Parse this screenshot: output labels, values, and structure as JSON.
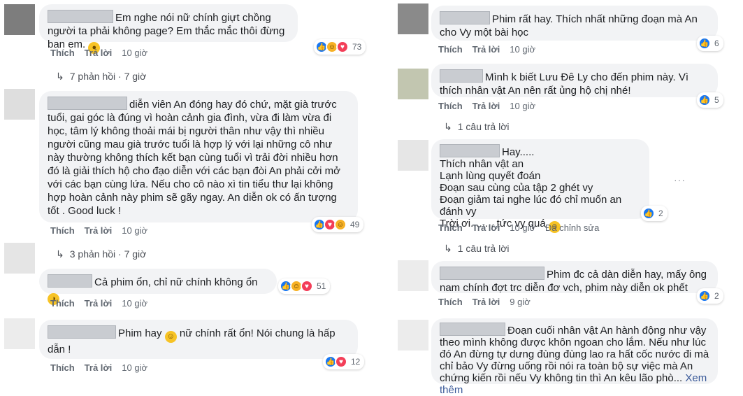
{
  "left": {
    "comments": [
      {
        "text": "Em nghe nói nữ chính giựt chồng người ta phải không page? Em thắc mắc thôi đừng ban em.",
        "emoji": "😣",
        "like": "Thích",
        "reply": "Trả lời",
        "time": "10 giờ",
        "reaction_count": "73"
      },
      {
        "text": "diễn viên An đóng hay đó chứ, mặt già trước tuổi, gai góc là đúng vì hoàn cảnh gia đình, vừa đi làm vừa đi học, tâm lý không thoải mái bị người thân như vậy thì nhiều người cũng mau già trước tuổi là hợp lý với lại những cô như này thường không thích kết bạn cùng tuổi vì trải đời nhiều hơn đó là giải thích hộ cho đạo diễn với các bạn đòi An phải cởi mở với các bạn cùng lứa. Nếu cho cô nào xì tin tiểu thư lại không hợp hoàn cảnh này phim sẽ gãy ngay. An diễn ok có ấn tượng tốt . Good luck !",
        "like": "Thích",
        "reply": "Trả lời",
        "time": "10 giờ",
        "reaction_count": "49"
      },
      {
        "text": "Cả phim ổn, chỉ nữ chính không ổn",
        "like": "Thích",
        "reply": "Trả lời",
        "time": "10 giờ",
        "reaction_count": "51"
      },
      {
        "text_a": "Phim hay",
        "text_b": "nữ chính rất ổn! Nói chung là hấp dẫn !",
        "like": "Thích",
        "reply": "Trả lời",
        "time": "10 giờ",
        "reaction_count": "12"
      }
    ],
    "replies": [
      {
        "label": "7 phản hồi",
        "time": "7 giờ"
      },
      {
        "label": "3 phản hồi",
        "time": "7 giờ"
      }
    ]
  },
  "right": {
    "comments": [
      {
        "text": "Phim rất hay. Thích nhất những đoạn mà An cho Vy một bài học",
        "like": "Thích",
        "reply": "Trả lời",
        "time": "10 giờ",
        "reaction_count": "6"
      },
      {
        "text": "Mình k biết Lưu Đê Ly cho đến phim này. Vì thích nhân vật An nên rất ủng hộ chị nhé!",
        "like": "Thích",
        "reply": "Trả lời",
        "time": "10 giờ",
        "reaction_count": "5"
      },
      {
        "lines": [
          "Hay.....",
          "Thích nhân vật an",
          "Lạnh lùng quyết đoán",
          "Đoạn sau cùng của tập 2 ghét vy",
          "Đoạn giảm tai nghe lúc đó chỉ muốn an đánh vy",
          "Trời ơi........ tức vy quá"
        ],
        "like": "Thích",
        "reply": "Trả lời",
        "time": "10 giờ",
        "edited": "Đã chỉnh sửa",
        "reaction_count": "2"
      },
      {
        "text": "Phim đc cả dàn diễn hay, mấy ông nam chính đợt trc diễn đơ vch, phim này diễn ok phết",
        "like": "Thích",
        "reply": "Trả lời",
        "time": "9 giờ",
        "reaction_count": "2"
      },
      {
        "text": "Đoạn cuối nhân vật An hành động như vậy theo mình không được khôn ngoan cho lắm. Nếu như lúc đó An đừng tự dưng đùng đùng lao ra hất cốc nước đi mà chỉ bảo Vy đừng uống rồi nói ra toàn bộ sự việc mà An chứng kiến rồi nếu Vy không tin thì An kêu lão phò...",
        "see_more": "Xem thêm"
      }
    ],
    "replies": [
      {
        "label": "1 câu trả lời"
      },
      {
        "label": "1 câu trả lời"
      }
    ]
  },
  "colors": {
    "like": "#1877f2",
    "love": "#f33e58",
    "haha": "#f7b125",
    "bubble": "#f2f3f5"
  },
  "icons": [
    "like-icon",
    "love-icon",
    "haha-icon",
    "reply-arrow-icon",
    "more-options-icon"
  ]
}
